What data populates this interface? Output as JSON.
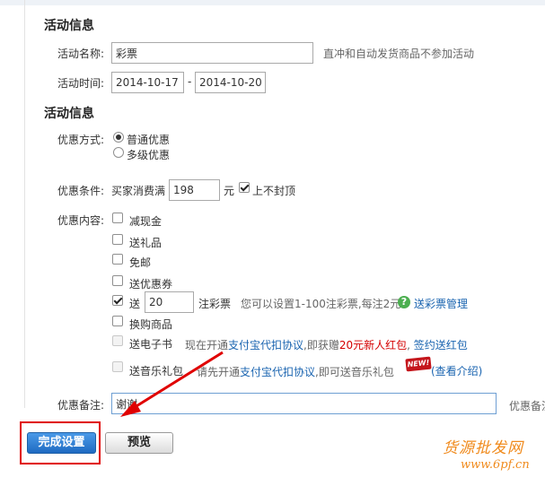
{
  "activity_info": {
    "title": "活动信息",
    "name_label": "活动名称:",
    "name_value": "彩票",
    "name_hint": "直冲和自动发货商品不参加活动",
    "time_label": "活动时间:",
    "start_date": "2014-10-17",
    "separator": "-",
    "end_date": "2014-10-20"
  },
  "discount_info": {
    "title": "活动信息",
    "method_label": "优惠方式:",
    "methods": [
      "普通优惠",
      "多级优惠"
    ],
    "condition_label": "优惠条件:",
    "condition_prefix": "买家消费满",
    "condition_value": "198",
    "condition_unit": "元",
    "no_cap_label": "上不封顶",
    "content_label": "优惠内容:",
    "options": {
      "cash": "减现金",
      "gift": "送礼品",
      "free_shipping": "免邮",
      "coupon": "送优惠券",
      "lottery": "送",
      "lottery_count": "20",
      "lottery_unit": "注彩票",
      "lottery_hint": "您可以设置1-100注彩票,每注2元",
      "lottery_link": "送彩票管理",
      "exchange": "换购商品",
      "ebook": "送电子书",
      "ebook_hint_1": "现在开通",
      "ebook_link_1": "支付宝代扣协议",
      "ebook_hint_2": ",即获赠",
      "ebook_red": "20元新人红包",
      "ebook_hint_3": ",",
      "ebook_link_2": "签约送红包",
      "music": "送音乐礼包",
      "music_hint_1": "请先开通",
      "music_link_1": "支付宝代扣协议",
      "music_hint_2": ",即可送音乐礼包",
      "new_badge": "NEW!",
      "music_link_2": "(查看介绍)"
    },
    "remark_label": "优惠备注:",
    "remark_value": "谢谢",
    "remark_hint": "优惠备注"
  },
  "buttons": {
    "submit": "完成设置",
    "preview": "预览"
  },
  "watermark": {
    "line1": "货源批发网",
    "line2": "www.6pf.cn"
  },
  "colors": {
    "link": "#1a64b0",
    "primary_button": "#1f6bc2",
    "highlight_box": "#e00000",
    "annotation_arrow": "#e00000",
    "watermark": "#f08a1c"
  }
}
